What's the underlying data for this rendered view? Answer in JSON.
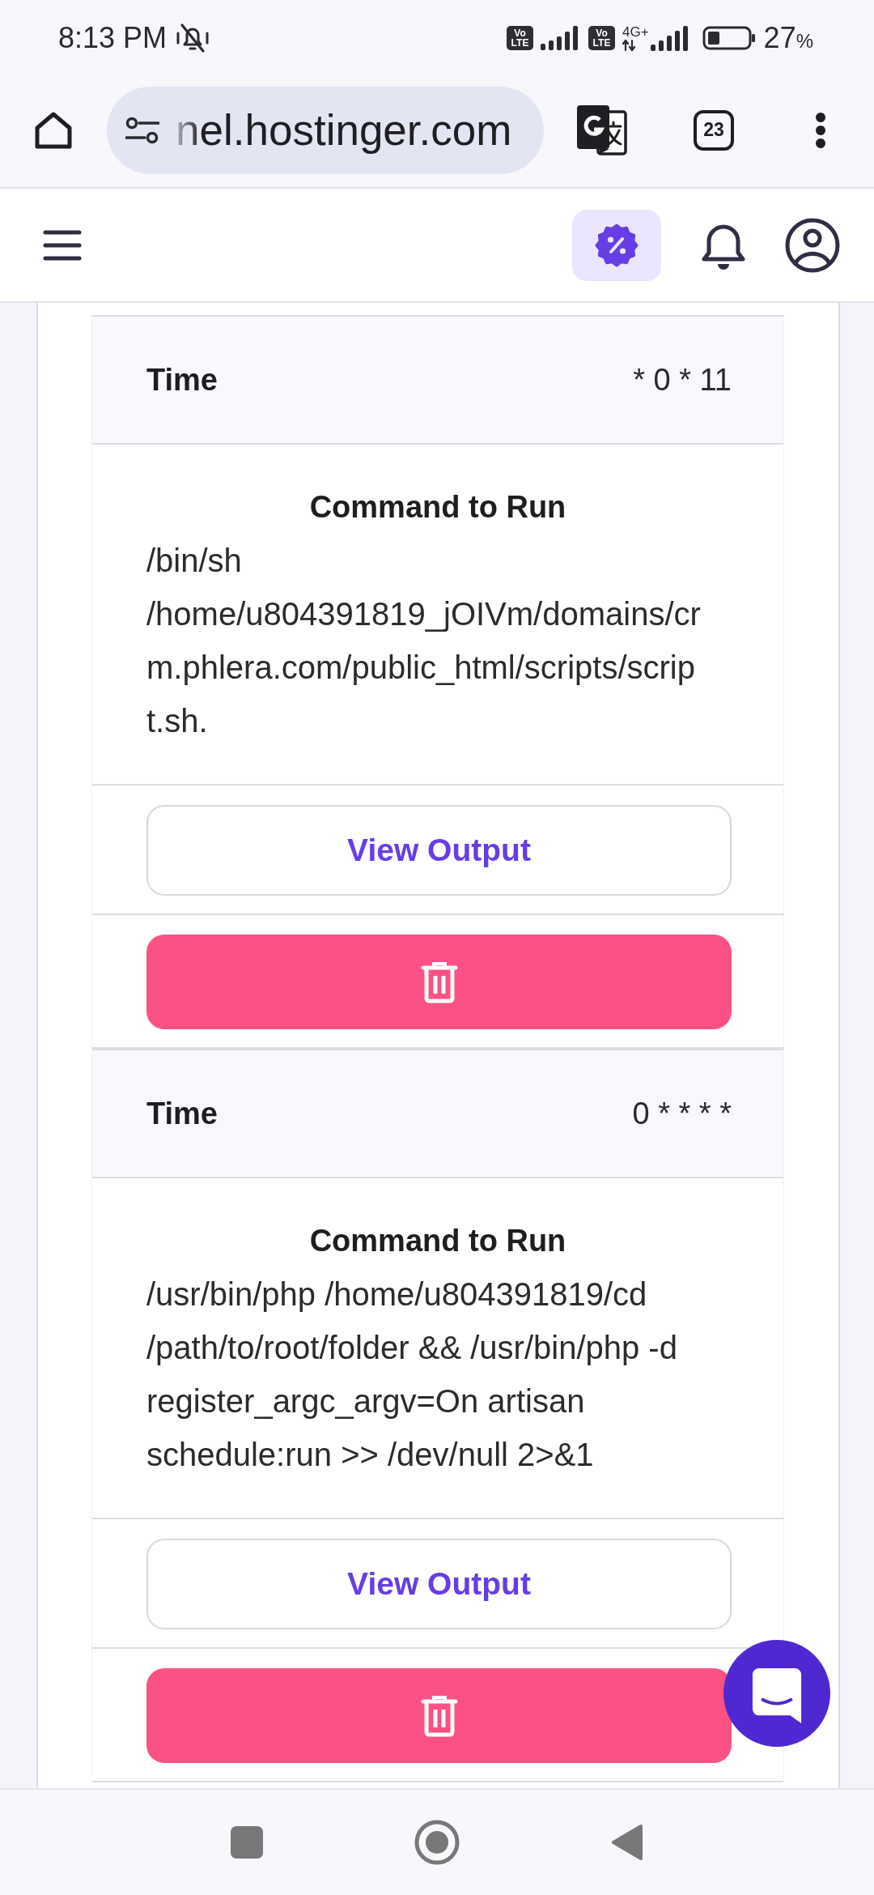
{
  "status_bar": {
    "time": "8:13 PM",
    "sim_badges": [
      "Vo LTE",
      "Vo LTE"
    ],
    "network_type": "4G+",
    "battery_percent": "27",
    "battery_unit": "%"
  },
  "browser": {
    "url": "nel.hostinger.com",
    "tab_count": "23"
  },
  "jobs": [
    {
      "time_label": "Time",
      "time_value": "* 0 * 11",
      "command_label": "Command to Run",
      "command": "/bin/sh /home/u804391819_jOIVm/domains/crm.phlera.com/public_html/scripts/script.sh.",
      "output_button": "View Output"
    },
    {
      "time_label": "Time",
      "time_value": "0 * * * *",
      "command_label": "Command to Run",
      "command": "/usr/bin/php /home/u804391819/cd /path/to/root/folder && /usr/bin/php -d register_argc_argv=On artisan schedule:run >> /dev/null 2>&1",
      "output_button": "View Output"
    }
  ]
}
